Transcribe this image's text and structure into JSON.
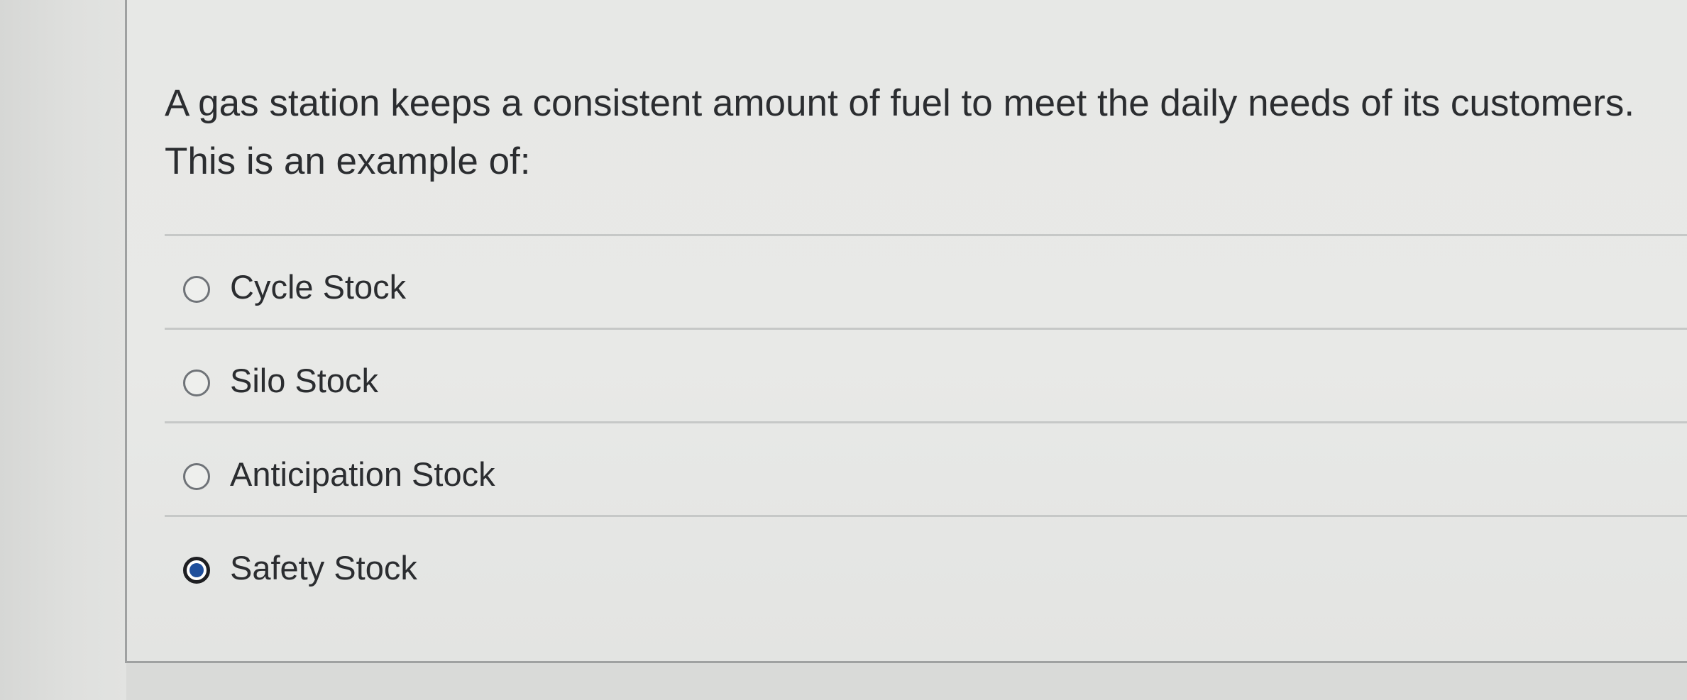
{
  "question": {
    "text": "A gas station keeps a consistent amount of fuel to meet the daily needs of its customers. This is an example of:"
  },
  "answers": [
    {
      "label": "Cycle Stock",
      "selected": false
    },
    {
      "label": "Silo Stock",
      "selected": false
    },
    {
      "label": "Anticipation Stock",
      "selected": false
    },
    {
      "label": "Safety Stock",
      "selected": true
    }
  ],
  "colors": {
    "selected_radio_fill": "#1f4f9c",
    "text": "#2b2d30"
  }
}
